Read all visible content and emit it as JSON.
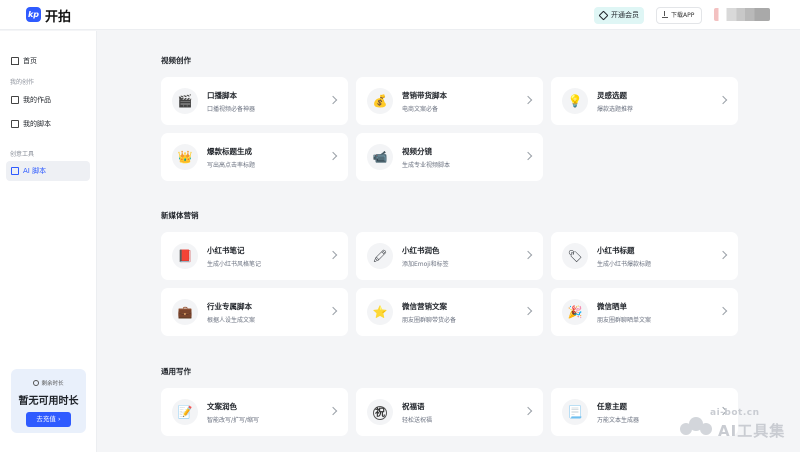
{
  "header": {
    "logo_mark": "kp",
    "app_name": "开拍",
    "vip_label": "开通会员",
    "download_label": "下载APP"
  },
  "sidebar": {
    "home": "首页",
    "group_creation": "我的创作",
    "my_works": "我的作品",
    "my_scripts": "我的脚本",
    "group_tools": "创意工具",
    "ai_script": "AI 脚本",
    "promo": {
      "subtitle": "剩余时长",
      "title": "暂无可用时长",
      "button": "去充值 ›"
    }
  },
  "sections": [
    {
      "title": "视频创作",
      "cards": [
        {
          "title": "口播脚本",
          "desc": "口播视频必备神器",
          "icon": "🎬",
          "icon_name": "clapper-icon"
        },
        {
          "title": "营销带货脚本",
          "desc": "电商文案必备",
          "icon": "💰",
          "icon_name": "money-bag-icon"
        },
        {
          "title": "灵感选题",
          "desc": "爆款选题推荐",
          "icon": "💡",
          "icon_name": "lightbulb-icon"
        },
        {
          "title": "爆款标题生成",
          "desc": "写出高点击率标题",
          "icon": "👑",
          "icon_name": "crown-icon"
        },
        {
          "title": "视频分镜",
          "desc": "生成专业视频脚本",
          "icon": "📹",
          "icon_name": "video-camera-icon"
        }
      ]
    },
    {
      "title": "新媒体营销",
      "cards": [
        {
          "title": "小红书笔记",
          "desc": "生成小红书风格笔记",
          "icon": "📕",
          "icon_name": "red-book-icon"
        },
        {
          "title": "小红书润色",
          "desc": "添加Emoji和标签",
          "icon": "🖍",
          "icon_name": "crayon-icon"
        },
        {
          "title": "小红书标题",
          "desc": "生成小红书爆款标题",
          "icon": "🏷",
          "icon_name": "tag-icon"
        },
        {
          "title": "行业专属脚本",
          "desc": "根据人设生成文案",
          "icon": "💼",
          "icon_name": "briefcase-icon"
        },
        {
          "title": "微信营销文案",
          "desc": "朋友圈群聊带货必备",
          "icon": "⭐",
          "icon_name": "star-icon"
        },
        {
          "title": "微信晒单",
          "desc": "朋友圈群聊晒单文案",
          "icon": "🎉",
          "icon_name": "party-popper-icon"
        }
      ]
    },
    {
      "title": "通用写作",
      "cards": [
        {
          "title": "文案润色",
          "desc": "智能改写/扩写/缩写",
          "icon": "📝",
          "icon_name": "memo-icon"
        },
        {
          "title": "祝福语",
          "desc": "轻松送祝福",
          "icon": "祝",
          "icon_name": "blessing-icon"
        },
        {
          "title": "任意主题",
          "desc": "万能文本生成器",
          "icon": "📃",
          "icon_name": "document-icon"
        }
      ]
    }
  ],
  "watermark": {
    "top": "ai-bot.cn",
    "main": "AI工具集"
  }
}
